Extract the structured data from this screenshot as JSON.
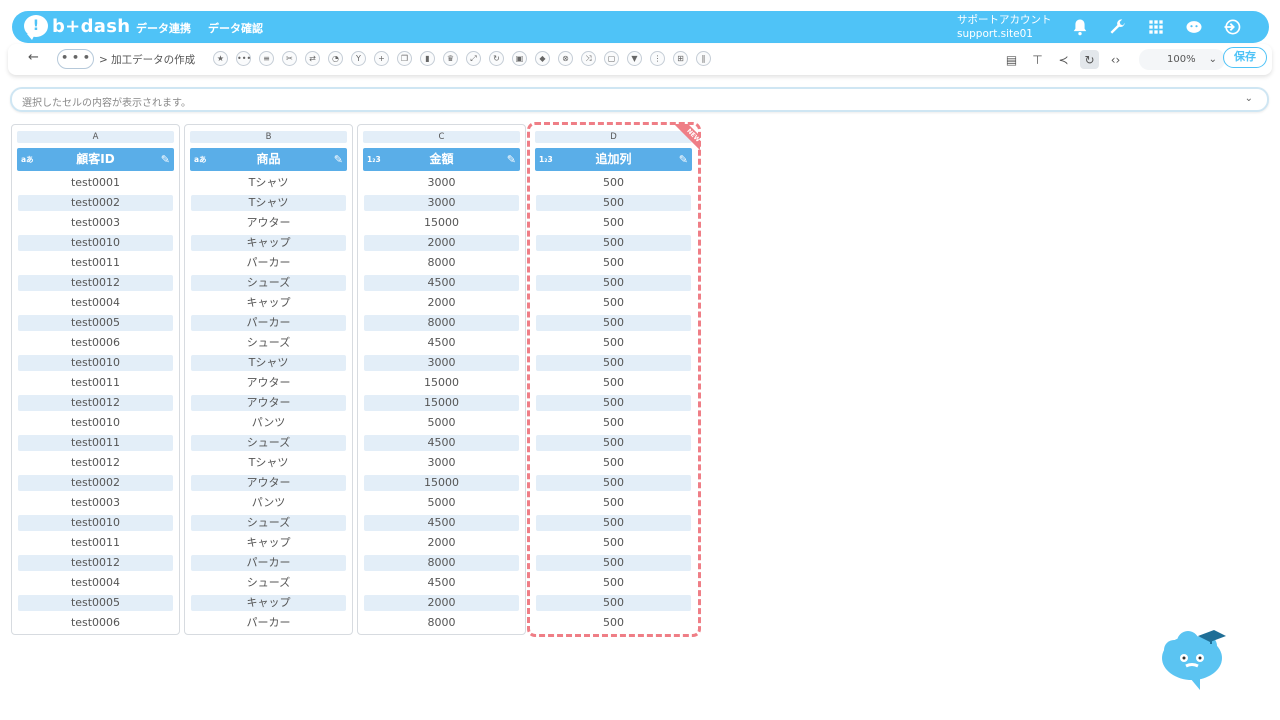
{
  "header": {
    "logo_mark": "!",
    "logo_text": "b+dash",
    "nav": [
      "データ連携",
      "データ確認"
    ],
    "account_name": "サポートアカウント",
    "account_site": "support.site01"
  },
  "toolbar": {
    "back": "←",
    "more": "• • •",
    "breadcrumb": "> 加工データの作成",
    "zoom": "100%",
    "save_label": "保存"
  },
  "cellbar": {
    "placeholder": "選択したセルの内容が表示されます。"
  },
  "ribbon": "NEW",
  "columns": [
    {
      "letter": "A",
      "type": "aあ",
      "name": "顧客ID",
      "values": [
        "test0001",
        "test0002",
        "test0003",
        "test0010",
        "test0011",
        "test0012",
        "test0004",
        "test0005",
        "test0006",
        "test0010",
        "test0011",
        "test0012",
        "test0010",
        "test0011",
        "test0012",
        "test0002",
        "test0003",
        "test0010",
        "test0011",
        "test0012",
        "test0004",
        "test0005",
        "test0006"
      ]
    },
    {
      "letter": "B",
      "type": "aあ",
      "name": "商品",
      "values": [
        "Tシャツ",
        "Tシャツ",
        "アウター",
        "キャップ",
        "パーカー",
        "シューズ",
        "キャップ",
        "パーカー",
        "シューズ",
        "Tシャツ",
        "アウター",
        "アウター",
        "パンツ",
        "シューズ",
        "Tシャツ",
        "アウター",
        "パンツ",
        "シューズ",
        "キャップ",
        "パーカー",
        "シューズ",
        "キャップ",
        "パーカー"
      ]
    },
    {
      "letter": "C",
      "type": "1₂3",
      "name": "金額",
      "values": [
        "3000",
        "3000",
        "15000",
        "2000",
        "8000",
        "4500",
        "2000",
        "8000",
        "4500",
        "3000",
        "15000",
        "15000",
        "5000",
        "4500",
        "3000",
        "15000",
        "5000",
        "4500",
        "2000",
        "8000",
        "4500",
        "2000",
        "8000"
      ]
    },
    {
      "letter": "D",
      "type": "1₂3",
      "name": "追加列",
      "values": [
        "500",
        "500",
        "500",
        "500",
        "500",
        "500",
        "500",
        "500",
        "500",
        "500",
        "500",
        "500",
        "500",
        "500",
        "500",
        "500",
        "500",
        "500",
        "500",
        "500",
        "500",
        "500",
        "500"
      ]
    }
  ],
  "colors": {
    "brand": "#4fc3f7",
    "header_cell": "#5aaee8",
    "alt_row": "#e3eef8",
    "new_highlight": "#ef7e86"
  }
}
